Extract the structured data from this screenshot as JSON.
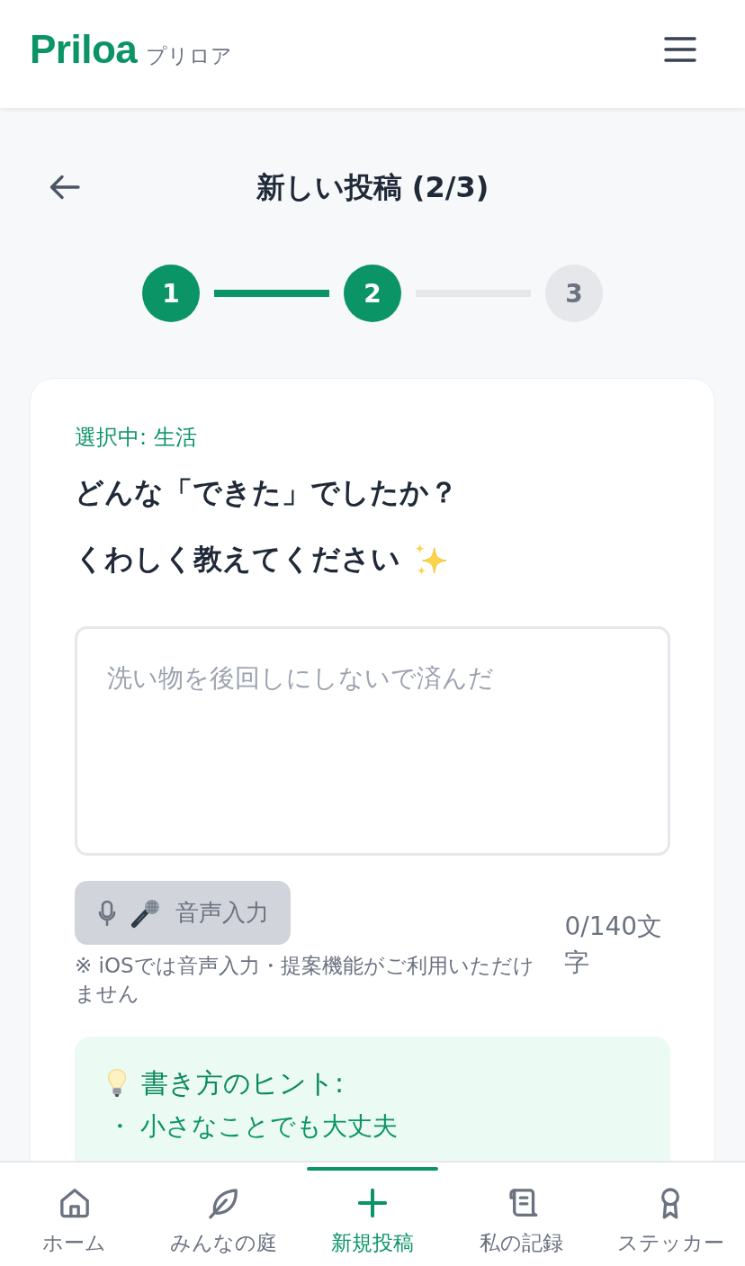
{
  "header": {
    "logo": "Priloa",
    "logo_kana": "プリロア"
  },
  "page": {
    "title": "新しい投稿 (2/3)"
  },
  "stepper": {
    "steps": [
      {
        "label": "1",
        "active": true
      },
      {
        "label": "2",
        "active": true
      },
      {
        "label": "3",
        "active": false
      }
    ]
  },
  "card": {
    "selected_category": "選択中: 生活",
    "question_lines": [
      "どんな「できた」でしたか？",
      "くわしく教えてください"
    ],
    "description_field": {
      "placeholder": "洗い物を後回しにしないで済んだ"
    },
    "voice_button": {
      "label": "音声入力",
      "disabled": true
    },
    "char_count": "0/140文字",
    "note": "※ iOSでは音声入力・提案機能がご利用いただけません",
    "hints": {
      "title": "書き方のヒント:",
      "items": [
        "・ 小さなことでも大丈夫"
      ]
    }
  },
  "bottom_nav": {
    "items": [
      {
        "label": "ホーム",
        "selected": false
      },
      {
        "label": "みんなの庭",
        "selected": false
      },
      {
        "label": "新規投稿",
        "selected": true
      },
      {
        "label": "私の記録",
        "selected": false
      },
      {
        "label": "ステッカー",
        "selected": false
      }
    ]
  }
}
